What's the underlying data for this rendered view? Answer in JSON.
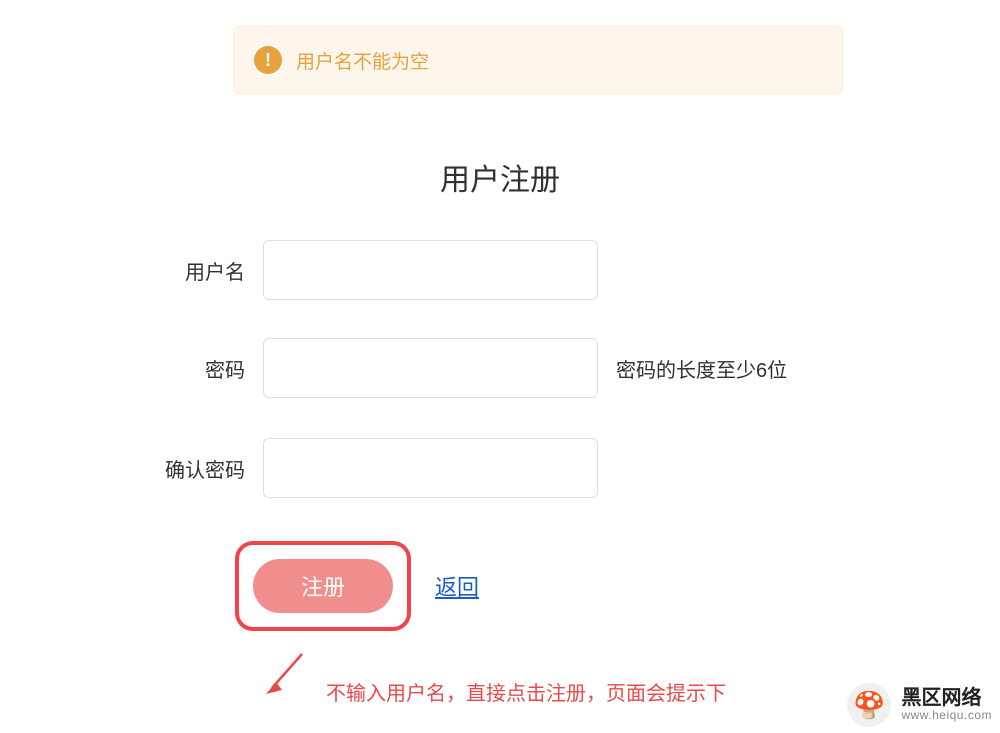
{
  "alert": {
    "icon_glyph": "!",
    "text": "用户名不能为空"
  },
  "form": {
    "title": "用户注册",
    "username": {
      "label": "用户名",
      "value": ""
    },
    "password": {
      "label": "密码",
      "value": "",
      "hint": "密码的长度至少6位"
    },
    "confirm": {
      "label": "确认密码",
      "value": ""
    }
  },
  "actions": {
    "register": "注册",
    "back": "返回"
  },
  "annotation": {
    "text": "不输入用户名，直接点击注册，页面会提示下"
  },
  "watermark": {
    "title": "黑区网络",
    "url": "www.heiqu.com",
    "logo_emoji": "🍄"
  }
}
